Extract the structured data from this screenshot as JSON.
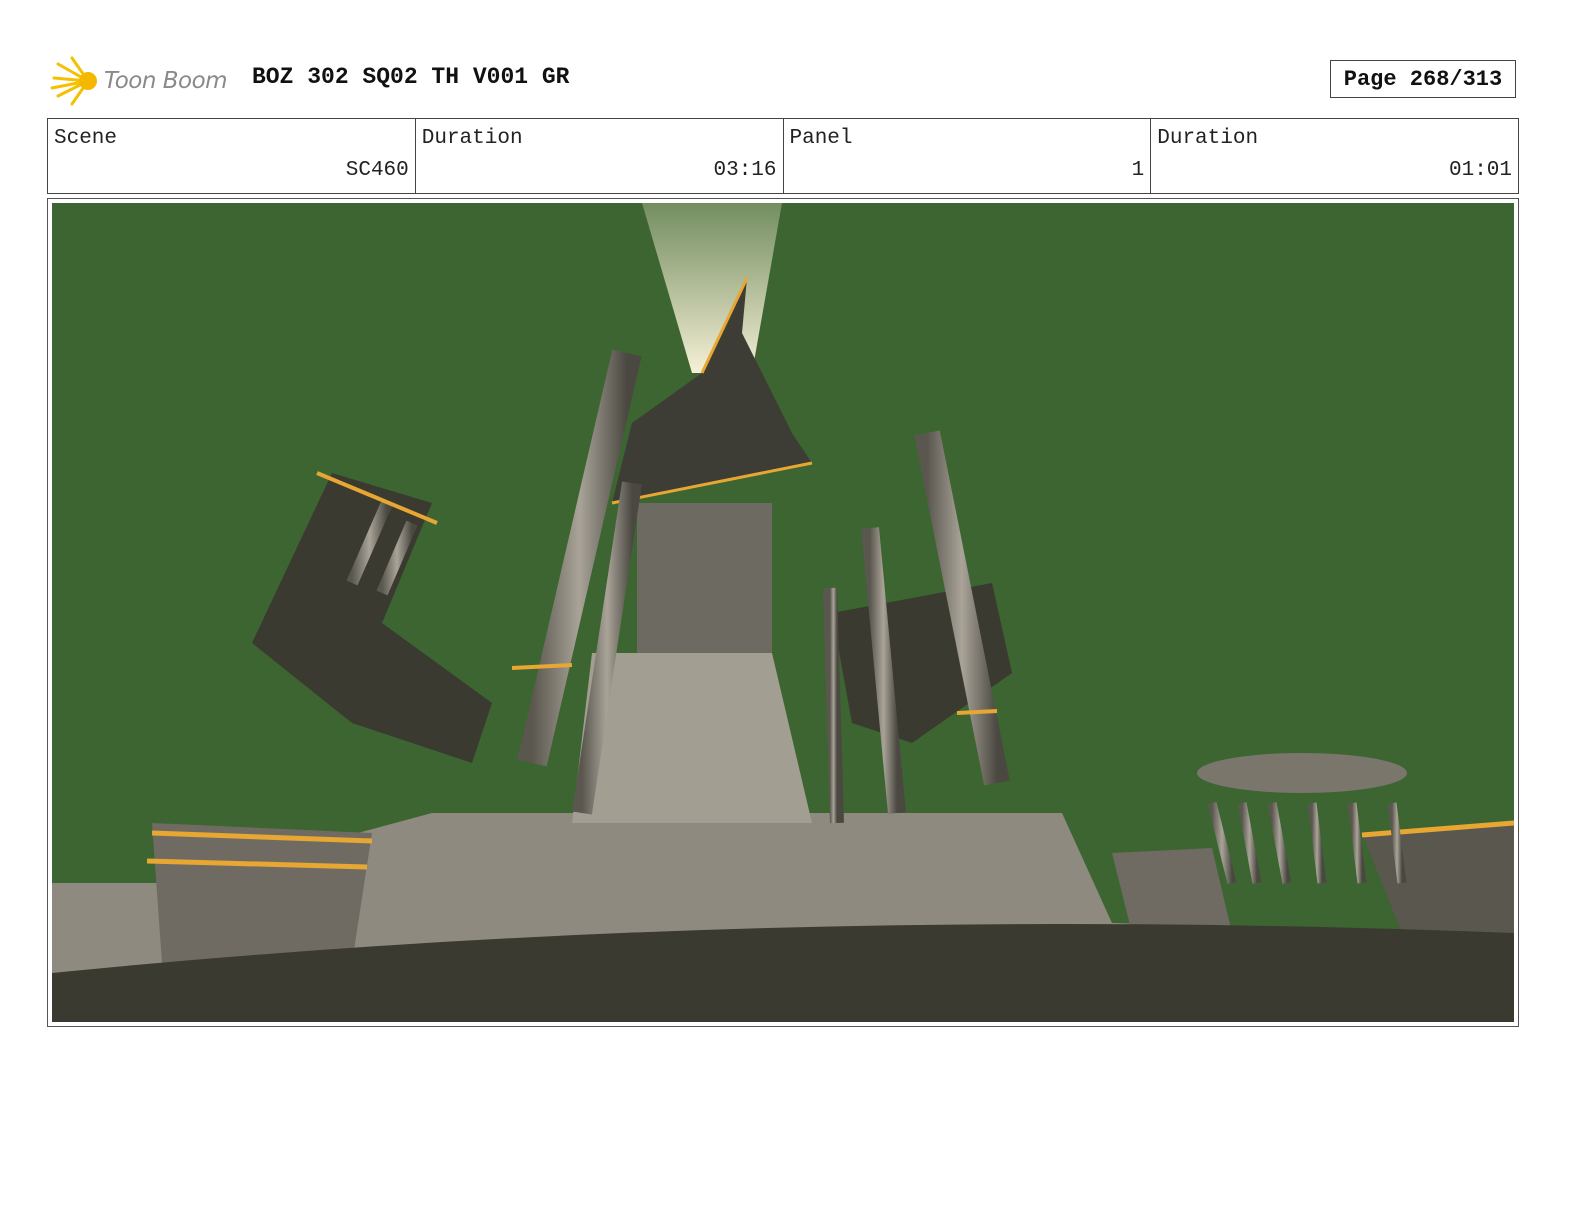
{
  "header": {
    "logo_text": "Toon Boom",
    "project_title": "BOZ 302 SQ02 TH V001 GR",
    "page_label": "Page 268/313"
  },
  "info": [
    {
      "label": "Scene",
      "value": "SC460"
    },
    {
      "label": "Duration",
      "value": "03:16"
    },
    {
      "label": "Panel",
      "value": "1"
    },
    {
      "label": "Duration",
      "value": "01:01"
    }
  ],
  "colors": {
    "sky": "#3c6531",
    "stone": "#8f8a80",
    "gold": "#e8a632",
    "ground": "#3b3a31"
  }
}
